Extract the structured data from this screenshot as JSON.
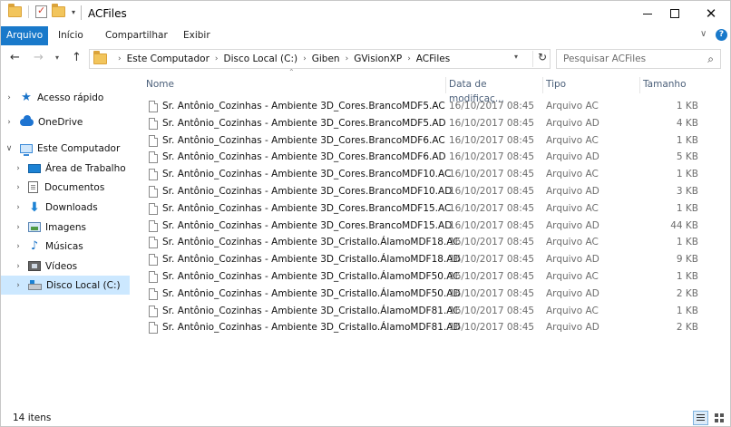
{
  "window": {
    "title": "ACFiles",
    "buttons": {
      "minimize": "minimize",
      "maximize": "maximize",
      "close": "✕"
    }
  },
  "ribbon": {
    "tabs": [
      "Arquivo",
      "Início",
      "Compartilhar",
      "Exibir"
    ],
    "expand_glyph": "∨",
    "help_glyph": "?"
  },
  "address": {
    "breadcrumbs": [
      "Este Computador",
      "Disco Local (C:)",
      "Giben",
      "GVisionXP",
      "ACFiles"
    ],
    "separator": "›"
  },
  "search": {
    "placeholder": "Pesquisar ACFiles"
  },
  "navpane": {
    "items": [
      {
        "label": "Acesso rápido",
        "icon": "star-icon",
        "indent": 0,
        "chevron": "›",
        "selected": false
      },
      {
        "label": "OneDrive",
        "icon": "cloud-icon",
        "indent": 0,
        "chevron": "›",
        "selected": false
      },
      {
        "label": "Este Computador",
        "icon": "computer-icon",
        "indent": 0,
        "chevron": "∨",
        "selected": false
      },
      {
        "label": "Área de Trabalho",
        "icon": "desktop-icon",
        "indent": 1,
        "chevron": "›",
        "selected": false
      },
      {
        "label": "Documentos",
        "icon": "documents-icon",
        "indent": 1,
        "chevron": "›",
        "selected": false
      },
      {
        "label": "Downloads",
        "icon": "downloads-icon",
        "indent": 1,
        "chevron": "›",
        "selected": false
      },
      {
        "label": "Imagens",
        "icon": "pictures-icon",
        "indent": 1,
        "chevron": "›",
        "selected": false
      },
      {
        "label": "Músicas",
        "icon": "music-icon",
        "indent": 1,
        "chevron": "›",
        "selected": false
      },
      {
        "label": "Vídeos",
        "icon": "videos-icon",
        "indent": 1,
        "chevron": "›",
        "selected": false
      },
      {
        "label": "Disco Local (C:)",
        "icon": "disk-icon",
        "indent": 1,
        "chevron": "›",
        "selected": true
      }
    ]
  },
  "columns": {
    "name": "Nome",
    "date": "Data de modificaç...",
    "type": "Tipo",
    "size": "Tamanho"
  },
  "files": [
    {
      "name": "Sr. Antônio_Cozinhas - Ambiente 3D_Cores.BrancoMDF5.AC",
      "date": "16/10/2017 08:45",
      "type": "Arquivo AC",
      "size": "1 KB"
    },
    {
      "name": "Sr. Antônio_Cozinhas - Ambiente 3D_Cores.BrancoMDF5.AD",
      "date": "16/10/2017 08:45",
      "type": "Arquivo AD",
      "size": "4 KB"
    },
    {
      "name": "Sr. Antônio_Cozinhas - Ambiente 3D_Cores.BrancoMDF6.AC",
      "date": "16/10/2017 08:45",
      "type": "Arquivo AC",
      "size": "1 KB"
    },
    {
      "name": "Sr. Antônio_Cozinhas - Ambiente 3D_Cores.BrancoMDF6.AD",
      "date": "16/10/2017 08:45",
      "type": "Arquivo AD",
      "size": "5 KB"
    },
    {
      "name": "Sr. Antônio_Cozinhas - Ambiente 3D_Cores.BrancoMDF10.AC",
      "date": "16/10/2017 08:45",
      "type": "Arquivo AC",
      "size": "1 KB"
    },
    {
      "name": "Sr. Antônio_Cozinhas - Ambiente 3D_Cores.BrancoMDF10.AD",
      "date": "16/10/2017 08:45",
      "type": "Arquivo AD",
      "size": "3 KB"
    },
    {
      "name": "Sr. Antônio_Cozinhas - Ambiente 3D_Cores.BrancoMDF15.AC",
      "date": "16/10/2017 08:45",
      "type": "Arquivo AC",
      "size": "1 KB"
    },
    {
      "name": "Sr. Antônio_Cozinhas - Ambiente 3D_Cores.BrancoMDF15.AD",
      "date": "16/10/2017 08:45",
      "type": "Arquivo AD",
      "size": "44 KB"
    },
    {
      "name": "Sr. Antônio_Cozinhas - Ambiente 3D_Cristallo.ÁlamoMDF18.AC",
      "date": "16/10/2017 08:45",
      "type": "Arquivo AC",
      "size": "1 KB"
    },
    {
      "name": "Sr. Antônio_Cozinhas - Ambiente 3D_Cristallo.ÁlamoMDF18.AD",
      "date": "16/10/2017 08:45",
      "type": "Arquivo AD",
      "size": "9 KB"
    },
    {
      "name": "Sr. Antônio_Cozinhas - Ambiente 3D_Cristallo.ÁlamoMDF50.AC",
      "date": "16/10/2017 08:45",
      "type": "Arquivo AC",
      "size": "1 KB"
    },
    {
      "name": "Sr. Antônio_Cozinhas - Ambiente 3D_Cristallo.ÁlamoMDF50.AD",
      "date": "16/10/2017 08:45",
      "type": "Arquivo AD",
      "size": "2 KB"
    },
    {
      "name": "Sr. Antônio_Cozinhas - Ambiente 3D_Cristallo.ÁlamoMDF81.AC",
      "date": "16/10/2017 08:45",
      "type": "Arquivo AC",
      "size": "1 KB"
    },
    {
      "name": "Sr. Antônio_Cozinhas - Ambiente 3D_Cristallo.ÁlamoMDF81.AD",
      "date": "16/10/2017 08:45",
      "type": "Arquivo AD",
      "size": "2 KB"
    }
  ],
  "status": {
    "item_count": "14 itens"
  },
  "colors": {
    "accent": "#1979ca",
    "selected_bg": "#cce8ff",
    "header_text": "#4c607a"
  }
}
